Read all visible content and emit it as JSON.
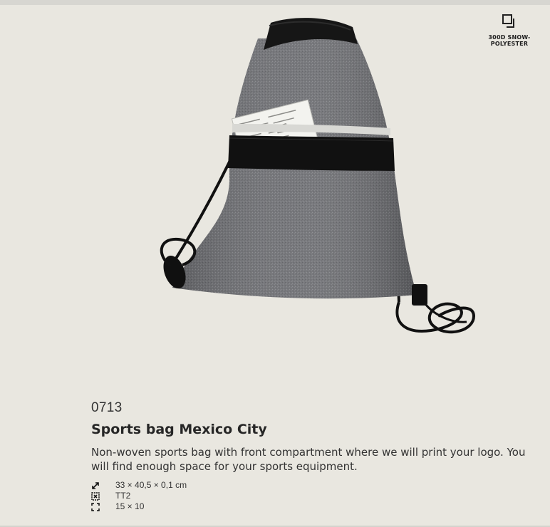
{
  "material": {
    "icon": "layered-fabric-icon",
    "label_line1": "300D SNOW-",
    "label_line2": "POLYESTER"
  },
  "product": {
    "image": "gray-drawstring-sports-bag-photo",
    "code": "0713",
    "title": "Sports bag Mexico City",
    "description": "Non-woven sports bag with front compartment where we will print your logo. You will find enough space for your sports equipment.",
    "specs": [
      {
        "icon": "dimensions-arrow-icon",
        "value": "33 × 40,5 × 0,1 cm"
      },
      {
        "icon": "print-technique-icon",
        "value": "TT2"
      },
      {
        "icon": "print-area-icon",
        "value": "15 × 10"
      }
    ]
  },
  "colors": {
    "background": "#e9e7e0",
    "bag_gray": "#6f7074",
    "strap_black": "#111111"
  }
}
